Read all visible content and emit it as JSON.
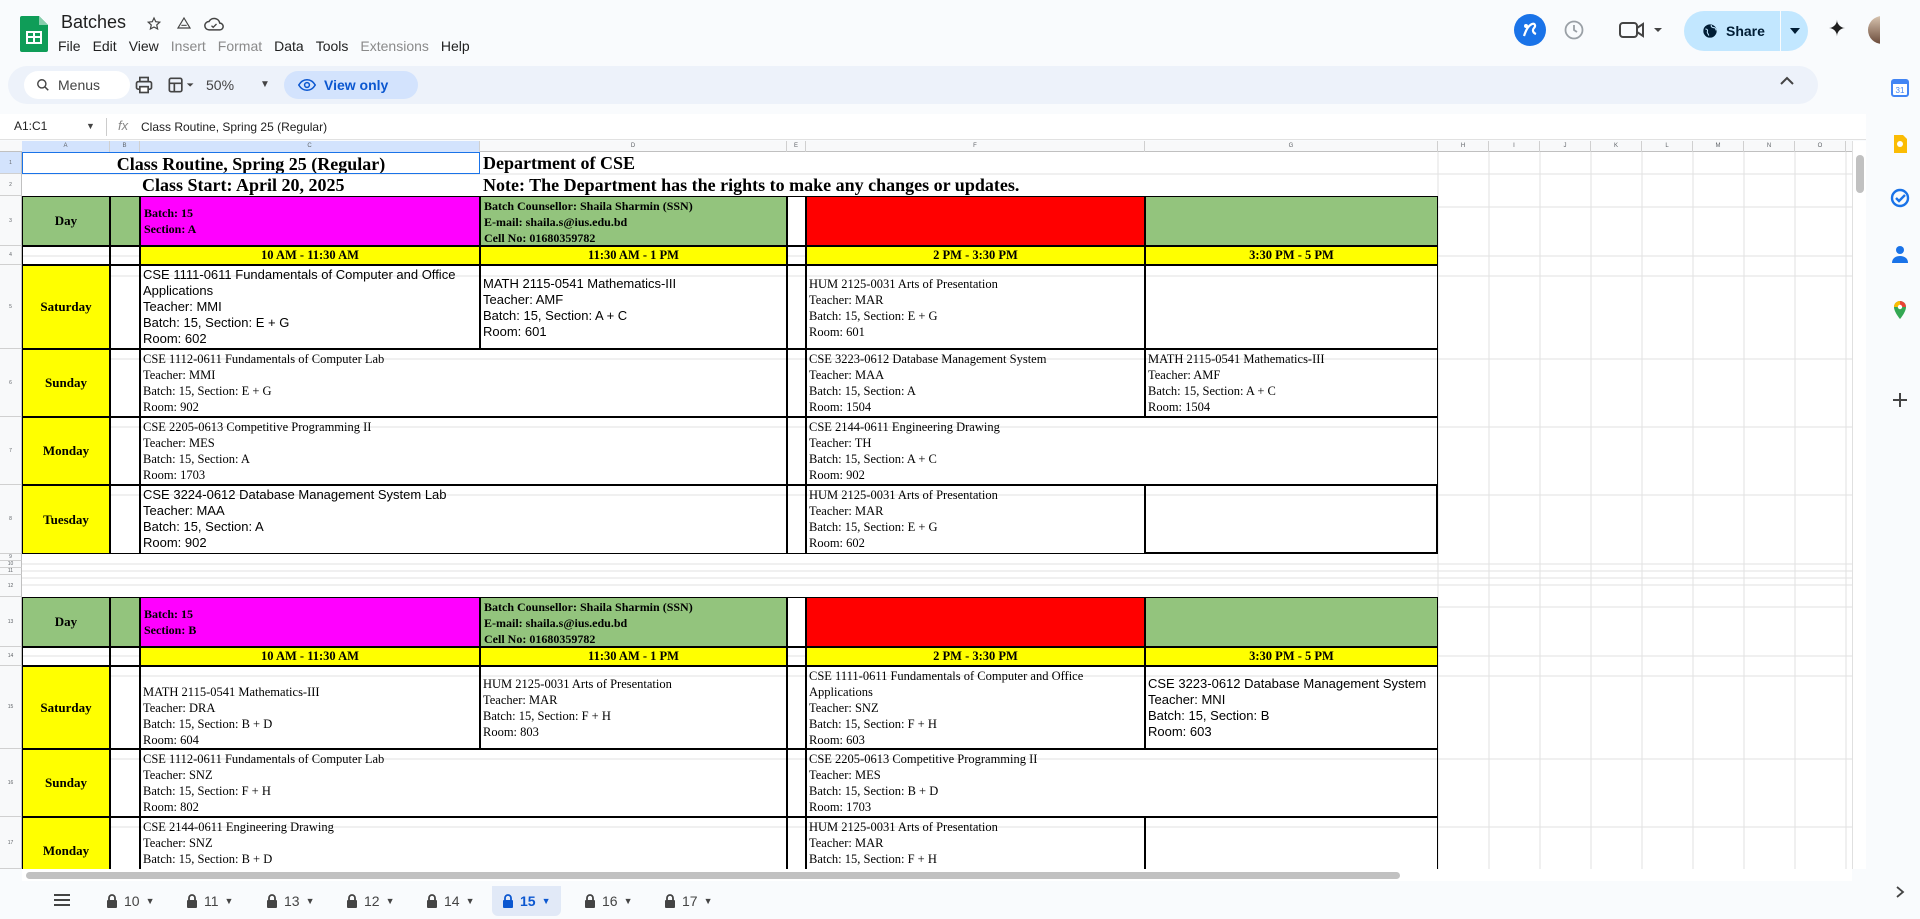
{
  "doc": {
    "title": "Batches"
  },
  "menu": [
    "File",
    "Edit",
    "View",
    "Insert",
    "Format",
    "Data",
    "Tools",
    "Extensions",
    "Help"
  ],
  "toolbar": {
    "search_label": "Menus",
    "zoom": "50%",
    "view_only": "View only"
  },
  "share": {
    "label": "Share"
  },
  "formula": {
    "cell_ref": "A1:C1",
    "content": "Class Routine, Spring 25 (Regular)"
  },
  "columns": [
    "A",
    "B",
    "C",
    "D",
    "E",
    "F",
    "G",
    "H",
    "I",
    "J",
    "K",
    "L",
    "M",
    "N",
    "O"
  ],
  "rows": [
    "1",
    "2",
    "3",
    "4",
    "5",
    "6",
    "7",
    "8",
    "9",
    "10",
    "11",
    "12",
    "13",
    "14",
    "15",
    "16",
    "17"
  ],
  "sheet": {
    "title": "Class Routine, Spring 25 (Regular)",
    "dept": "Department of CSE",
    "start": "Class Start: April 20, 2025",
    "note": "Note: The Department has the rights to make any changes or updates.",
    "blockA": {
      "day_label": "Day",
      "batch_line1": "Batch: 15",
      "batch_line2": "Section: A",
      "couns1": "Batch Counsellor: Shaila Sharmin (SSN)",
      "couns2": "E-mail: shaila.s@ius.edu.bd",
      "couns3": "Cell No: 01680359782",
      "times": [
        "10 AM - 11:30 AM",
        "11:30 AM - 1 PM",
        "2 PM - 3:30 PM",
        "3:30 PM - 5 PM"
      ],
      "days": [
        "Saturday",
        "Sunday",
        "Monday",
        "Tuesday"
      ],
      "sat_c": [
        "CSE 1111-0611 Fundamentals of Computer and Office Applications",
        "Teacher: MMI",
        "Batch: 15, Section: E + G",
        "Room: 602"
      ],
      "sat_d": [
        "MATH 2115-0541 Mathematics-III",
        "Teacher: AMF",
        "Batch: 15, Section: A + C",
        "Room: 601"
      ],
      "sat_f": [
        "HUM 2125-0031 Arts of Presentation",
        "Teacher: MAR",
        "Batch: 15, Section: E + G",
        "Room: 601"
      ],
      "sun_cd": [
        "CSE 1112-0611 Fundamentals of Computer Lab",
        "Teacher: MMI",
        "Batch: 15, Section: E + G",
        "Room: 902"
      ],
      "sun_f": [
        "CSE 3223-0612 Database Management System",
        "Teacher: MAA",
        "Batch: 15, Section: A",
        "Room: 1504"
      ],
      "sun_g": [
        "MATH 2115-0541 Mathematics-III",
        "Teacher: AMF",
        "Batch: 15, Section: A + C",
        "Room: 1504"
      ],
      "mon_cd": [
        "CSE 2205-0613 Competitive Programming II",
        "Teacher: MES",
        "Batch: 15, Section: A",
        "Room: 1703"
      ],
      "mon_fg": [
        "CSE 2144-0611 Engineering Drawing",
        "Teacher: TH",
        "Batch: 15, Section: A + C",
        "Room: 902"
      ],
      "tue_cd": [
        "CSE 3224-0612 Database Management System Lab",
        "Teacher: MAA",
        "Batch: 15, Section: A",
        "Room: 902"
      ],
      "tue_f": [
        "HUM 2125-0031 Arts of Presentation",
        "Teacher: MAR",
        "Batch: 15, Section: E + G",
        "Room: 602"
      ]
    },
    "blockB": {
      "day_label": "Day",
      "batch_line1": "Batch: 15",
      "batch_line2": "Section: B",
      "couns1": "Batch Counsellor: Shaila Sharmin (SSN)",
      "couns2": "E-mail: shaila.s@ius.edu.bd",
      "couns3": "Cell No: 01680359782",
      "times": [
        "10 AM - 11:30 AM",
        "11:30 AM - 1 PM",
        "2 PM - 3:30 PM",
        "3:30 PM - 5 PM"
      ],
      "days": [
        "Saturday",
        "Sunday",
        "Monday"
      ],
      "sat_c": [
        "MATH 2115-0541 Mathematics-III",
        "Teacher: DRA",
        "Batch: 15, Section: B + D",
        "Room: 604"
      ],
      "sat_d": [
        "HUM 2125-0031 Arts of Presentation",
        "Teacher: MAR",
        "Batch: 15, Section: F + H",
        "Room: 803"
      ],
      "sat_f": [
        "CSE 1111-0611 Fundamentals of Computer and Office Applications",
        "Teacher: SNZ",
        "Batch: 15, Section: F + H",
        "Room: 603"
      ],
      "sat_g": [
        "CSE 3223-0612 Database Management System",
        "Teacher: MNI",
        "Batch: 15, Section: B",
        "Room: 603"
      ],
      "sun_cd": [
        "CSE 1112-0611 Fundamentals of Computer Lab",
        "Teacher: SNZ",
        "Batch: 15, Section: F + H",
        "Room: 802"
      ],
      "sun_fg": [
        "CSE 2205-0613 Competitive Programming II",
        "Teacher: MES",
        "Batch: 15, Section: B + D",
        "Room: 1703"
      ],
      "mon_cd": [
        "CSE 2144-0611 Engineering Drawing",
        "Teacher: SNZ",
        "Batch: 15, Section: B + D"
      ],
      "mon_f": [
        "HUM 2125-0031 Arts of Presentation",
        "Teacher: MAR",
        "Batch: 15, Section: F + H"
      ]
    }
  },
  "tabs": [
    {
      "label": "10"
    },
    {
      "label": "11"
    },
    {
      "label": "13"
    },
    {
      "label": "12"
    },
    {
      "label": "14"
    },
    {
      "label": "15"
    },
    {
      "label": "16"
    },
    {
      "label": "17"
    }
  ],
  "colors": {
    "accent": "#0b57d0",
    "yellow": "#ffff00",
    "magenta": "#ff00ff",
    "green": "#93c47d",
    "red": "#ff0000"
  }
}
